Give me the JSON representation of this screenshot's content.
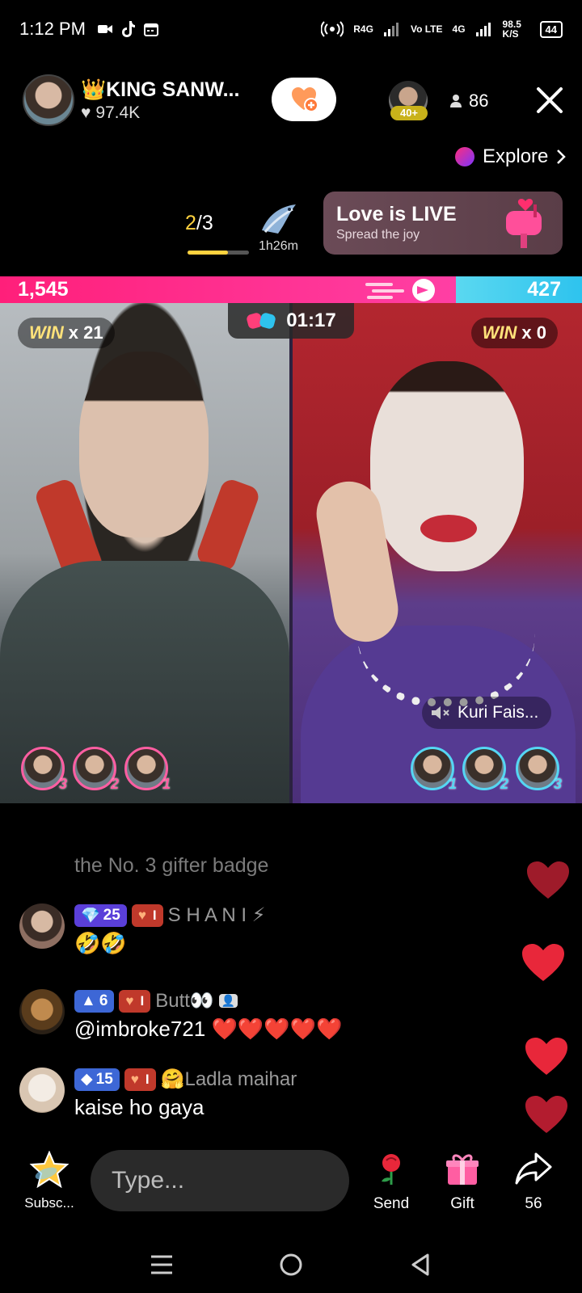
{
  "status_bar": {
    "time": "1:12 PM",
    "network": "R4G",
    "volte": "Vo LTE",
    "lte": "4G",
    "speed": "98.5 K/S",
    "battery": "44"
  },
  "header": {
    "host_name": "👑KING SANW...",
    "host_likes": "97.4K",
    "top_viewer_badge": "40+",
    "viewer_count": "86"
  },
  "explore": {
    "label": "Explore"
  },
  "ranking": {
    "current": "2",
    "total": "/3",
    "progress": 0.66,
    "hour_time": "1h26m"
  },
  "promo": {
    "title": "Love is LIVE",
    "subtitle": "Spread the joy"
  },
  "battle": {
    "score_left": "1,545",
    "score_right": "427",
    "timer": "01:17",
    "left_win_label": "WIN",
    "left_win_count": "x 21",
    "right_win_label": "WIN",
    "right_win_count": "x 0",
    "opponent_name": "Kuri Fais...",
    "left_gifters": [
      "3",
      "2",
      "1"
    ],
    "right_gifters": [
      "1",
      "2",
      "3"
    ]
  },
  "chat": {
    "faded_message": "the No. 3 gifter badge",
    "messages": [
      {
        "level": "25",
        "fan_level": "I",
        "user": "S H A N I ⚡",
        "text": "🤣🤣"
      },
      {
        "level": "6",
        "fan_level": "I",
        "user": "Butt👀",
        "text": "@imbroke721 ❤️❤️❤️❤️❤️"
      },
      {
        "level": "15",
        "fan_level": "I",
        "user": "🤗Ladla maihar",
        "text": "kaise ho gaya"
      }
    ]
  },
  "bottom_bar": {
    "subscribe_label": "Subsc...",
    "input_placeholder": "Type...",
    "send_label": "Send",
    "gift_label": "Gift",
    "share_count": "56"
  },
  "colors": {
    "left_score": "#ff1f7a",
    "right_score": "#2ec3ee",
    "win_text": "#ffe27a",
    "rank_accent": "#ffd23f",
    "heart": "#e8273a"
  }
}
